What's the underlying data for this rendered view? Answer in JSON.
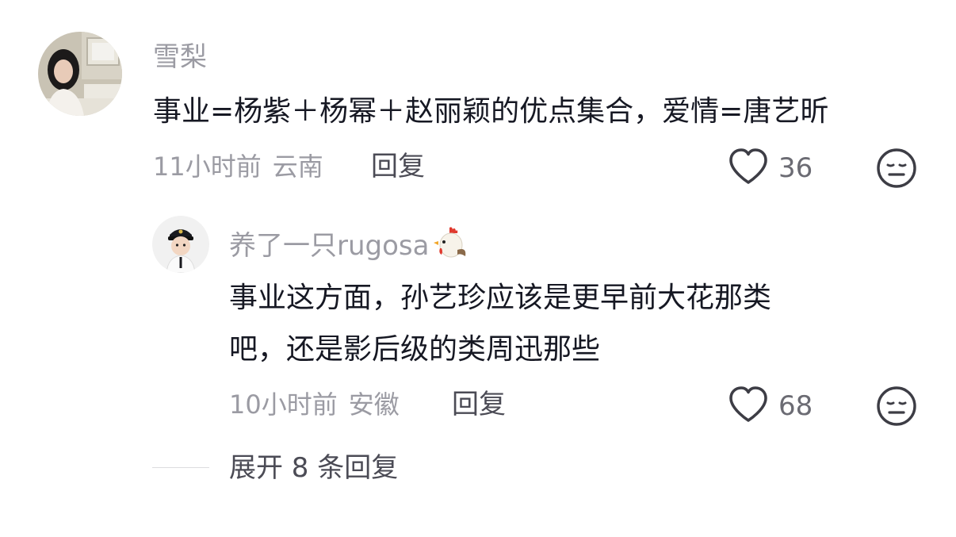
{
  "comment": {
    "username": "雪梨",
    "text": "事业=杨紫＋杨幂＋赵丽颖的优点集合，爱情=唐艺昕",
    "time": "11小时前",
    "location": "云南",
    "reply_label": "回复",
    "like_count": "36"
  },
  "reply": {
    "username": "养了一只rugosa",
    "username_emoji": "rooster-emoji",
    "text_line1": "事业这方面，孙艺珍应该是更早前大花那类",
    "text_line2": "吧，还是影后级的类周迅那些",
    "time": "10小时前",
    "location": "安徽",
    "reply_label": "回复",
    "like_count": "68"
  },
  "expand_label": "展开 8 条回复",
  "icons": {
    "like": "heart-outline-icon",
    "dislike": "neutral-face-icon"
  },
  "colors": {
    "text_primary": "#161823",
    "text_secondary": "#9b9ba3",
    "icon": "#3d3d45"
  }
}
